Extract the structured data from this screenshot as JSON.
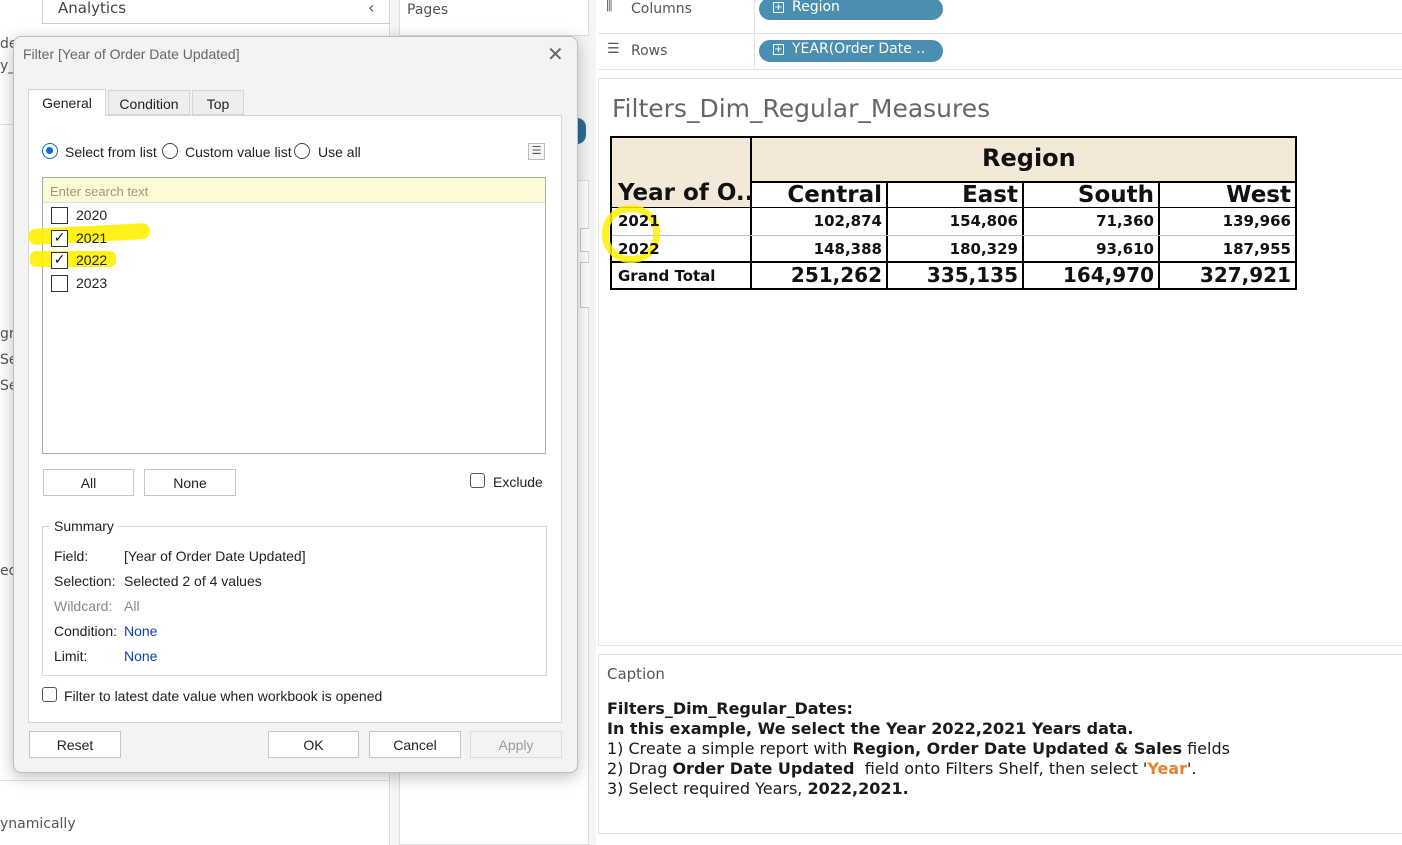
{
  "left_pane": {
    "analytics_label": "Analytics",
    "fragments": [
      "de",
      "y_",
      "gr",
      "Se",
      "Se",
      "ed"
    ],
    "bottom_hint": "ynamically"
  },
  "pages_label": "Pages",
  "shelves": {
    "columns_label": "Columns",
    "rows_label": "Rows",
    "columns_pill": "Region",
    "rows_pill": "YEAR(Order Date .."
  },
  "sheet": {
    "title": "Filters_Dim_Regular_Measures",
    "crosstab": {
      "column_header": "Region",
      "row_header": "Year of O..",
      "columns": [
        "Central",
        "East",
        "South",
        "West"
      ],
      "rows": [
        {
          "label": "2021",
          "values": [
            "102,874",
            "154,806",
            "71,360",
            "139,966"
          ]
        },
        {
          "label": "2022",
          "values": [
            "148,388",
            "180,329",
            "93,610",
            "187,955"
          ]
        }
      ],
      "total": {
        "label": "Grand Total",
        "values": [
          "251,262",
          "335,135",
          "164,970",
          "327,921"
        ]
      }
    }
  },
  "caption": {
    "label": "Caption",
    "line1": "Filters_Dim_Regular_Dates:",
    "line2": "In this example, We select the Year 2022,2021 Years data.",
    "line3_a": "1) Create a simple report with ",
    "line3_b": "Region, Order Date Updated & Sales",
    "line3_c": " fields",
    "line4_a": "2) Drag ",
    "line4_b": "Order Date Updated",
    "line4_c": "  field onto Filters Shelf, then select '",
    "line4_d": "Year",
    "line4_e": "'.",
    "line5_a": "3) Select required Years, ",
    "line5_b": "2022,2021."
  },
  "dialog": {
    "title": "Filter [Year of Order Date Updated]",
    "close_glyph": "✕",
    "tabs": [
      "General",
      "Condition",
      "Top"
    ],
    "radio_options": [
      "Select from list",
      "Custom value list",
      "Use all"
    ],
    "selected_radio": "Select from list",
    "search_placeholder": "Enter search text",
    "list_items": [
      {
        "label": "2020",
        "checked": false
      },
      {
        "label": "2021",
        "checked": true
      },
      {
        "label": "2022",
        "checked": true
      },
      {
        "label": "2023",
        "checked": false
      }
    ],
    "check_glyph": "✓",
    "all_button": "All",
    "none_button": "None",
    "exclude_label": "Exclude",
    "summary": {
      "title": "Summary",
      "field_label": "Field:",
      "field_value": "[Year of Order Date Updated]",
      "selection_label": "Selection:",
      "selection_value": "Selected 2 of 4 values",
      "wildcard_label": "Wildcard:",
      "wildcard_value": "All",
      "condition_label": "Condition:",
      "condition_value": "None",
      "limit_label": "Limit:",
      "limit_value": "None"
    },
    "latest_date_label": "Filter to latest date value when workbook is opened",
    "reset_button": "Reset",
    "ok_button": "OK",
    "cancel_button": "Cancel",
    "apply_button": "Apply"
  },
  "colors": {
    "pill": "#4a8fb0",
    "header_fill": "#f4e9d8",
    "highlighter": "#fff000",
    "accent_blue": "#0b6bc3",
    "orange": "#e8822e"
  }
}
